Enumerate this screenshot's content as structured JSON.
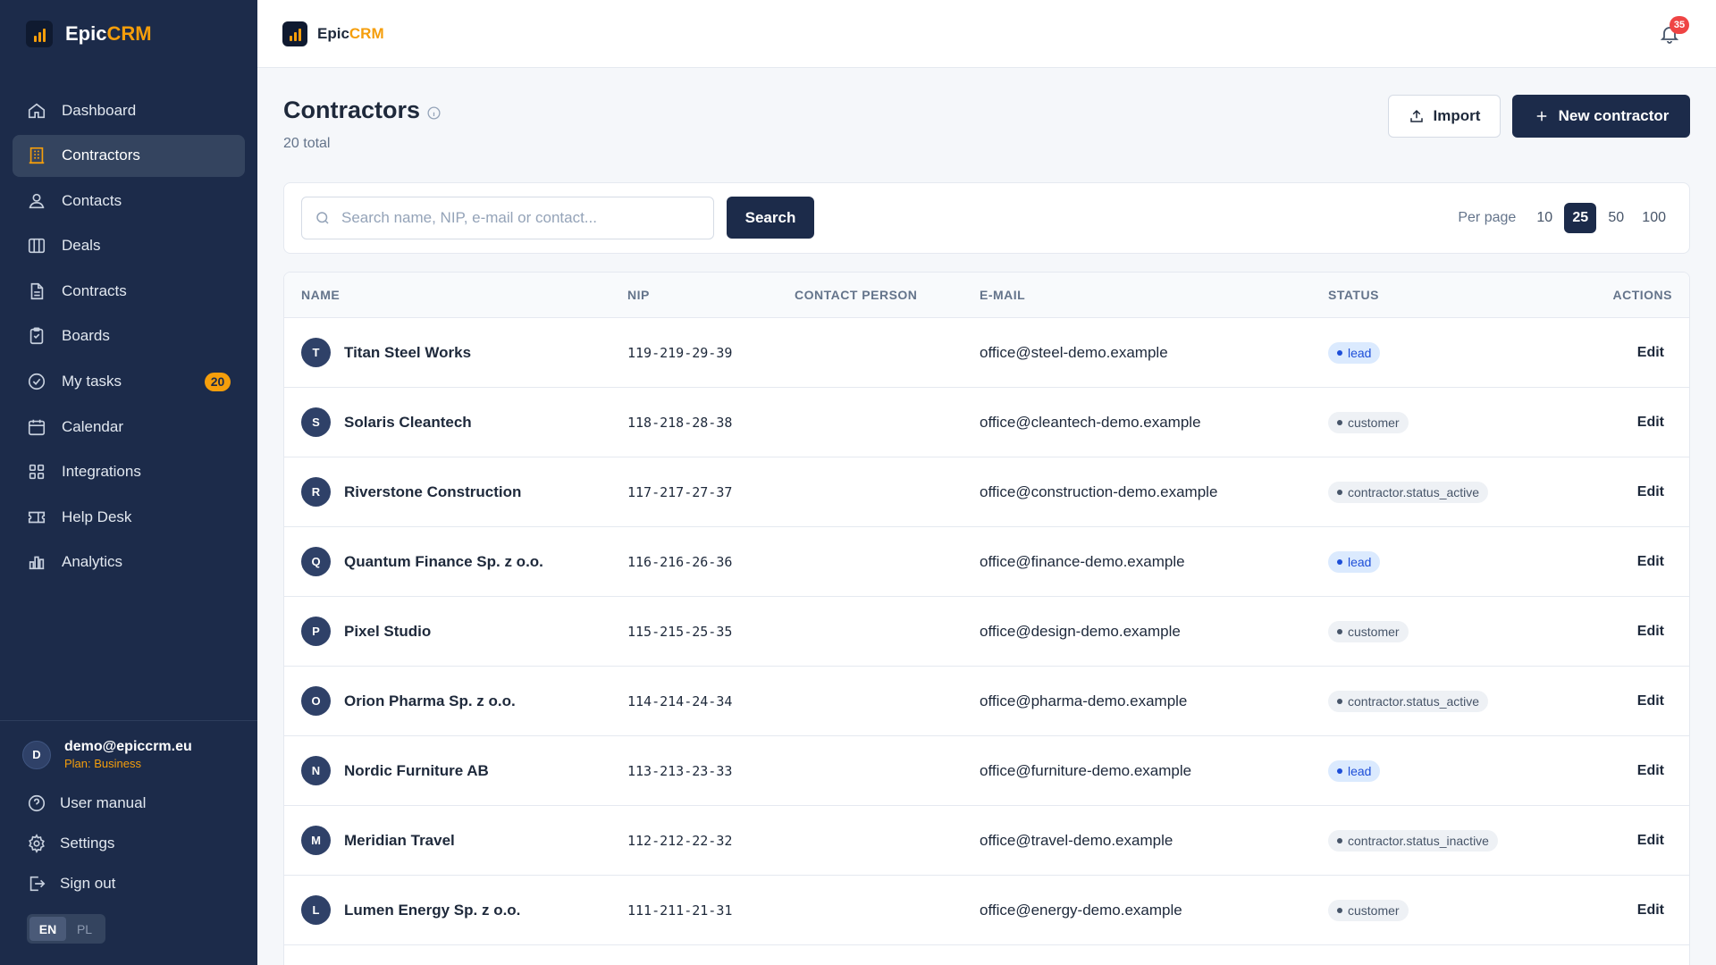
{
  "brand": {
    "name_prefix": "Epic",
    "name_accent": "CRM"
  },
  "sidebar": {
    "items": [
      {
        "label": "Dashboard"
      },
      {
        "label": "Contractors"
      },
      {
        "label": "Contacts"
      },
      {
        "label": "Deals"
      },
      {
        "label": "Contracts"
      },
      {
        "label": "Boards"
      },
      {
        "label": "My tasks",
        "badge": "20"
      },
      {
        "label": "Calendar"
      },
      {
        "label": "Integrations"
      },
      {
        "label": "Help Desk"
      },
      {
        "label": "Analytics"
      }
    ],
    "active_item": "Contractors",
    "user": {
      "initial": "D",
      "email": "demo@epiccrm.eu",
      "plan": "Plan: Business"
    },
    "bottom": {
      "manual": "User manual",
      "settings": "Settings",
      "signout": "Sign out"
    },
    "lang": {
      "en": "EN",
      "pl": "PL",
      "selected": "EN"
    }
  },
  "topbar": {
    "notifications_count": "35"
  },
  "page": {
    "title": "Contractors",
    "subtitle": "20 total",
    "import_label": "Import",
    "new_label": "New contractor"
  },
  "filter": {
    "search_placeholder": "Search name, NIP, e-mail or contact...",
    "search_value": "",
    "search_button": "Search",
    "per_page_label": "Per page",
    "per_page_options": [
      "10",
      "25",
      "50",
      "100"
    ],
    "per_page_selected": "25"
  },
  "table": {
    "columns": {
      "name": "NAME",
      "nip": "NIP",
      "contact": "CONTACT PERSON",
      "email": "E-MAIL",
      "status": "STATUS",
      "actions": "ACTIONS"
    },
    "action_label": "Edit",
    "rows": [
      {
        "initial": "T",
        "name": "Titan Steel Works",
        "nip": "119-219-29-39",
        "contact": "",
        "email": "office@steel-demo.example",
        "status": "lead"
      },
      {
        "initial": "S",
        "name": "Solaris Cleantech",
        "nip": "118-218-28-38",
        "contact": "",
        "email": "office@cleantech-demo.example",
        "status": "customer"
      },
      {
        "initial": "R",
        "name": "Riverstone Construction",
        "nip": "117-217-27-37",
        "contact": "",
        "email": "office@construction-demo.example",
        "status": "contractor.status_active"
      },
      {
        "initial": "Q",
        "name": "Quantum Finance Sp. z o.o.",
        "nip": "116-216-26-36",
        "contact": "",
        "email": "office@finance-demo.example",
        "status": "lead"
      },
      {
        "initial": "P",
        "name": "Pixel Studio",
        "nip": "115-215-25-35",
        "contact": "",
        "email": "office@design-demo.example",
        "status": "customer"
      },
      {
        "initial": "O",
        "name": "Orion Pharma Sp. z o.o.",
        "nip": "114-214-24-34",
        "contact": "",
        "email": "office@pharma-demo.example",
        "status": "contractor.status_active"
      },
      {
        "initial": "N",
        "name": "Nordic Furniture AB",
        "nip": "113-213-23-33",
        "contact": "",
        "email": "office@furniture-demo.example",
        "status": "lead"
      },
      {
        "initial": "M",
        "name": "Meridian Travel",
        "nip": "112-212-22-32",
        "contact": "",
        "email": "office@travel-demo.example",
        "status": "contractor.status_inactive"
      },
      {
        "initial": "L",
        "name": "Lumen Energy Sp. z o.o.",
        "nip": "111-211-21-31",
        "contact": "",
        "email": "office@energy-demo.example",
        "status": "customer"
      }
    ]
  },
  "colors": {
    "sidebar_bg": "#1c2b4a",
    "accent": "#f59e0b",
    "primary": "#1c2b4a",
    "notification": "#ef4444",
    "lead_badge": "#dbeafe"
  }
}
